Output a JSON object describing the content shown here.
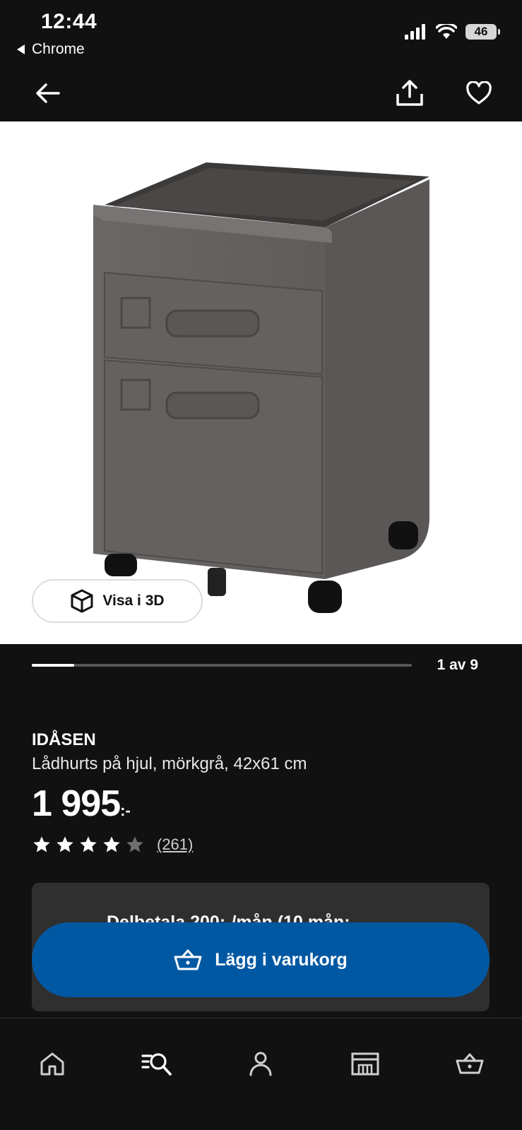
{
  "status_bar": {
    "time": "12:44",
    "back_app": "Chrome",
    "battery": "46"
  },
  "product_image": {
    "counter": "1 av 9",
    "progress_fraction": 0.111,
    "view3d_label": "Visa i 3D"
  },
  "product": {
    "brand": "IDÅSEN",
    "description": "Lådhurts på hjul, mörkgrå, 42x61 cm",
    "price": "1 995",
    "price_suffix": ":-",
    "rating_stars": 4,
    "rating_max": 5,
    "review_count": "(261)"
  },
  "financing_text": "Delbetala 200:-/mån (10 mån;",
  "cart_button_label": "Lägg i varukorg",
  "tabs": [
    "home-icon",
    "search-icon",
    "account-icon",
    "store-icon",
    "basket-icon"
  ],
  "colors": {
    "accent": "#0058a3",
    "background": "#111111",
    "panel": "#2f2f2f"
  }
}
